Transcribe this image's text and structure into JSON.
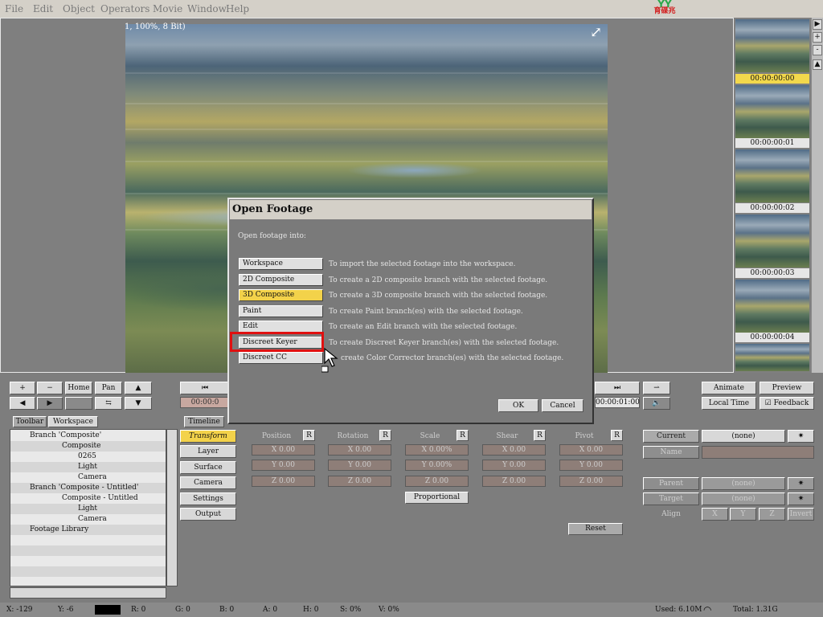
{
  "menu": [
    "File",
    "Edit",
    "Object",
    "Operators",
    "Movie",
    "Window",
    "Help"
  ],
  "logo": {
    "mark": "YY",
    "caption": "育碟兆"
  },
  "viewer": {
    "info": "1, 100%, 8 Bit)"
  },
  "thumbnails": {
    "timecodes": [
      "00:00:00:00",
      "00:00:00:01",
      "00:00:00:02",
      "00:00:00:03",
      "00:00:00:04"
    ]
  },
  "scroll_buttons": [
    "▶",
    "+",
    "-"
  ],
  "transport": {
    "left_buttons": [
      "+",
      "−",
      "Home",
      "Pan"
    ],
    "timecode_in": "00:00:0",
    "timecode_out": "00:00:01:00",
    "animate": "Animate",
    "preview": "Preview",
    "local_time": "Local Time",
    "feedback": "Feedback"
  },
  "tabs": [
    "Toolbar",
    "Workspace",
    "Timeline"
  ],
  "tree": [
    "Branch 'Composite'",
    "Composite",
    "0265",
    "Light",
    "Camera",
    "Branch 'Composite - Untitled'",
    "Composite - Untitled",
    "Light",
    "Camera",
    "Footage Library"
  ],
  "side_buttons": [
    "Transform",
    "Layer",
    "Surface",
    "Camera",
    "Settings",
    "Output"
  ],
  "transform": {
    "columns": [
      "Position",
      "Rotation",
      "Scale",
      "Shear",
      "Pivot"
    ],
    "col_btn": "R",
    "rows": [
      [
        "X 0.00",
        "X 0.00",
        "X 0.00%",
        "X 0.00",
        "X 0.00"
      ],
      [
        "Y 0.00",
        "Y 0.00",
        "Y 0.00%",
        "Y 0.00",
        "Y 0.00"
      ],
      [
        "Z 0.00",
        "Z 0.00",
        "Z 0.00",
        "Z 0.00",
        "Z 0.00"
      ]
    ],
    "proportional": "Proportional",
    "reset": "Reset"
  },
  "right_panel": {
    "current_label": "Current",
    "current_value": "(none)",
    "name_label": "Name",
    "parent_label": "Parent",
    "parent_value": "(none)",
    "target_label": "Target",
    "target_value": "(none)",
    "align_label": "Align",
    "align_buttons": [
      "X",
      "Y",
      "Z",
      "Invert"
    ]
  },
  "status": {
    "x": "X: -129",
    "y": "Y: -6",
    "r": "R: 0",
    "g": "G: 0",
    "b": "B: 0",
    "a": "A: 0",
    "h": "H: 0",
    "s": "S: 0%",
    "v": "V: 0%",
    "used": "Used: 6.10M",
    "total": "Total: 1.31G"
  },
  "dialog": {
    "title": "Open Footage",
    "prompt": "Open footage into:",
    "options": [
      {
        "label": "Workspace",
        "desc": "To import the selected footage into the workspace."
      },
      {
        "label": "2D Composite",
        "desc": "To create a 2D composite branch with the selected footage."
      },
      {
        "label": "3D Composite",
        "desc": "To create a 3D composite branch with the selected footage."
      },
      {
        "label": "Paint",
        "desc": "To create Paint branch(es) with the selected footage."
      },
      {
        "label": "Edit",
        "desc": "To create an Edit branch with the selected footage."
      },
      {
        "label": "Discreet Keyer",
        "desc": "To create Discreet Keyer branch(es) with the selected footage."
      },
      {
        "label": "Discreet CC",
        "desc": "create Color Corrector branch(es) with the selected footage."
      }
    ],
    "ok": "OK",
    "cancel": "Cancel"
  },
  "colors": {
    "highlight": "#f3d24a",
    "annotation": "#e01010"
  }
}
